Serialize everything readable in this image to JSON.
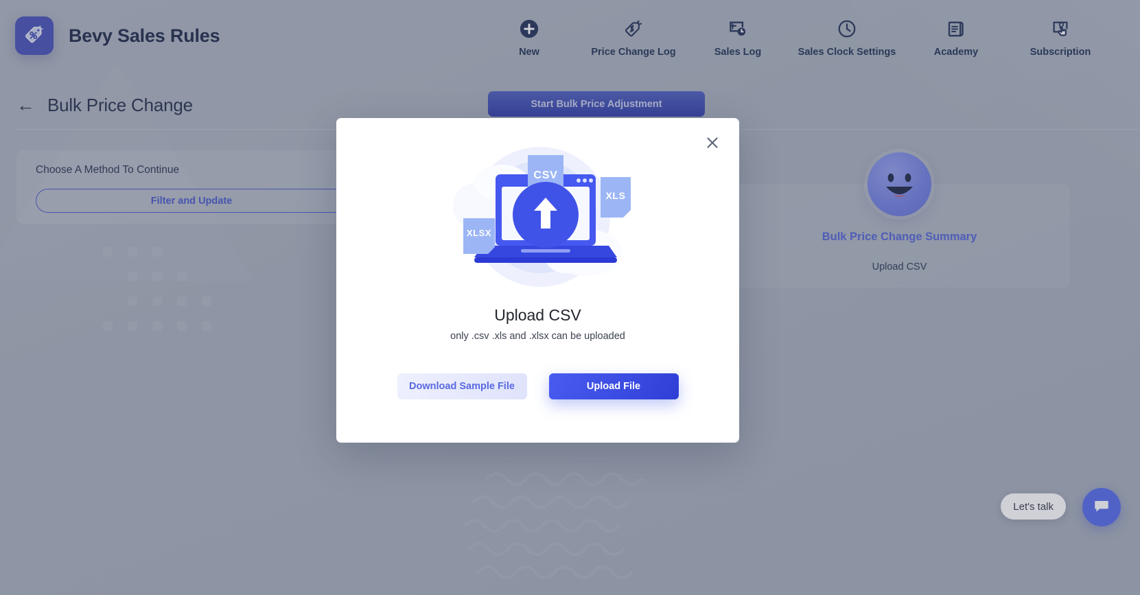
{
  "header": {
    "brand_title": "Bevy Sales Rules",
    "logo_icon": "price-tag-percent-icon",
    "nav": [
      {
        "label": "New",
        "icon": "plus-circle-icon"
      },
      {
        "label": "Price Change Log",
        "icon": "price-tag-dollar-icon"
      },
      {
        "label": "Sales Log",
        "icon": "document-clock-icon"
      },
      {
        "label": "Sales Clock Settings",
        "icon": "clock-icon"
      },
      {
        "label": "Academy",
        "icon": "book-icon"
      },
      {
        "label": "Subscription",
        "icon": "tap-click-icon"
      }
    ]
  },
  "page": {
    "back_icon": "arrow-left-icon",
    "title": "Bulk Price Change",
    "start_button": "Start Bulk Price Adjustment"
  },
  "method_card": {
    "label": "Choose A Method To Continue",
    "filter_button": "Filter and Update"
  },
  "summary_card": {
    "smiley_icon": "smiley-face-icon",
    "title": "Bulk Price Change Summary",
    "subtitle": "Upload CSV"
  },
  "modal": {
    "close_icon": "close-icon",
    "illustration": {
      "name": "laptop-upload-illustration",
      "upload_icon": "upload-arrow-icon",
      "file_badges": [
        "CSV",
        "XLS",
        "XLSX"
      ]
    },
    "title": "Upload CSV",
    "subtitle": "only .csv .xls and .xlsx can be uploaded",
    "download_sample_label": "Download Sample File",
    "upload_file_label": "Upload File"
  },
  "chat": {
    "pill_label": "Let's talk",
    "fab_icon": "chat-bubble-icon"
  },
  "colors": {
    "brand_navy": "#101c3d",
    "logo_blue": "#3b46b0",
    "accent_blue": "#3d4ec4",
    "primary_button": "#2f3fd6",
    "page_bg": "#a4abb8",
    "summary_link": "#4a5ad1"
  }
}
